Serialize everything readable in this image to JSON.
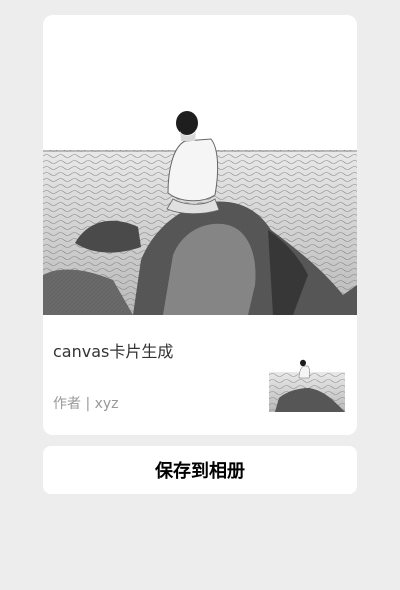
{
  "card": {
    "title": "canvas卡片生成",
    "author": "作者 | xyz",
    "image_icon": "seaside-rock-photo-icon",
    "thumb_icon": "seaside-rock-thumbnail-icon"
  },
  "actions": {
    "save_label": "保存到相册"
  },
  "colors": {
    "page_background": "#ededed",
    "card_background": "#ffffff",
    "title_text": "#333333",
    "meta_text": "#999999"
  }
}
